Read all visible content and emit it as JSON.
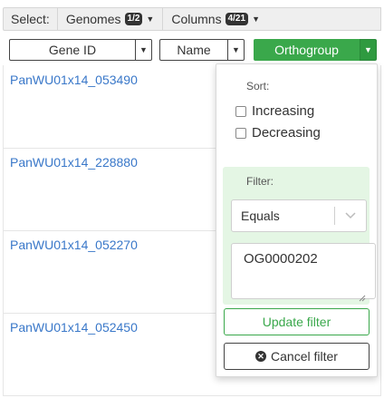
{
  "toolbar": {
    "select_label": "Select:",
    "genomes_label": "Genomes",
    "genomes_badge": "1/2",
    "columns_label": "Columns",
    "columns_badge": "4/21"
  },
  "columns": [
    {
      "label": "Gene ID"
    },
    {
      "label": "Name"
    },
    {
      "label": "Orthogroup"
    }
  ],
  "genes": [
    "PanWU01x14_053490",
    "PanWU01x14_228880",
    "PanWU01x14_052270",
    "PanWU01x14_052450"
  ],
  "dropdown": {
    "sort_title": "Sort:",
    "sort_options": [
      "Increasing",
      "Decreasing"
    ],
    "filter_title": "Filter:",
    "filter_operator": "Equals",
    "filter_value": "OG0000202",
    "update_label": "Update filter",
    "cancel_label": "Cancel filter"
  },
  "colors": {
    "accent_green": "#3aa84b",
    "link_blue": "#3a78c9",
    "filter_bg": "#e4f6e4"
  }
}
